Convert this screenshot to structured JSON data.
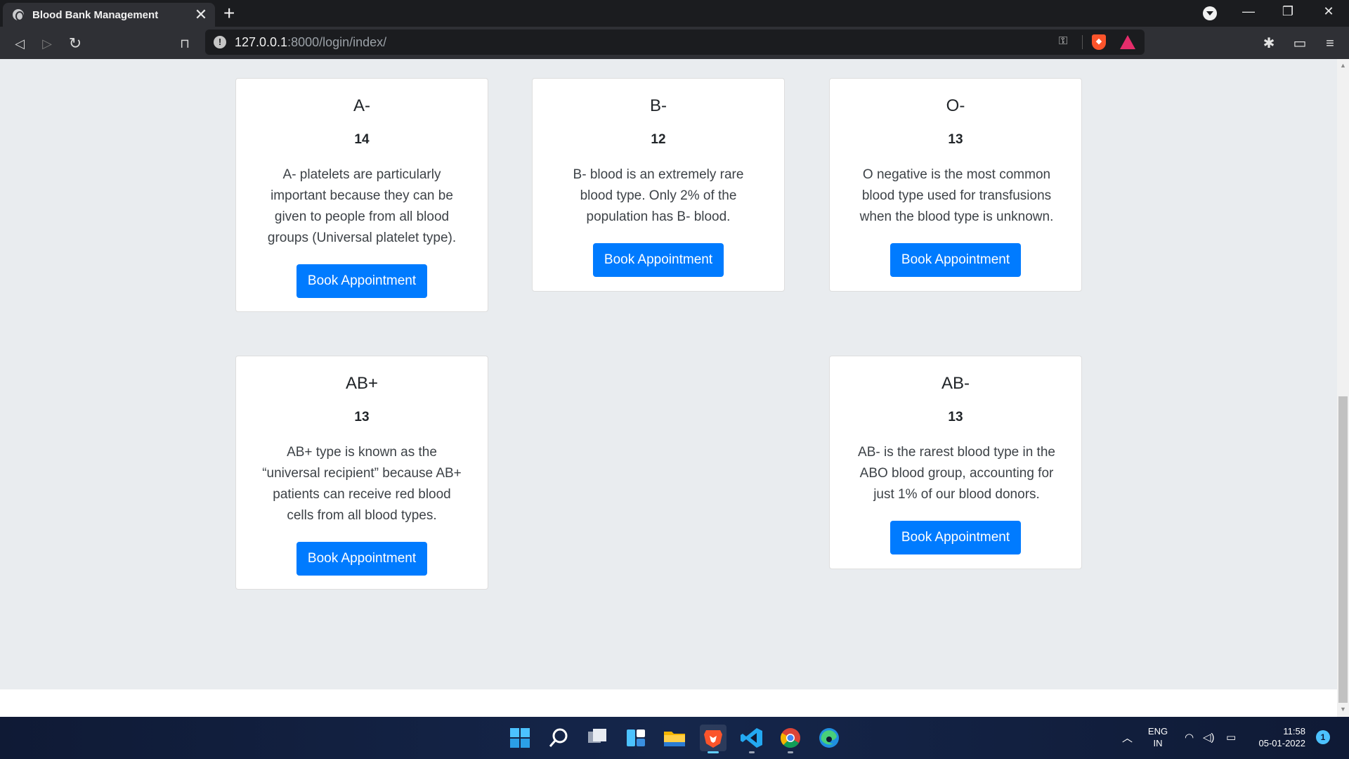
{
  "browser": {
    "tab_title": "Blood Bank Management",
    "tab_close": "✕",
    "new_tab": "+",
    "url_host": "127.0.0.1",
    "url_path": ":8000/login/index/",
    "window_controls": {
      "minimize": "—",
      "restore": "❐",
      "close": "✕"
    }
  },
  "cards": [
    {
      "group": "A-",
      "count": "14",
      "description": "A- platelets are particularly important because they can be given to people from all blood groups (Universal platelet type).",
      "button": "Book Appointment"
    },
    {
      "group": "B-",
      "count": "12",
      "description": "B- blood is an extremely rare blood type. Only 2% of the population has B- blood.",
      "button": "Book Appointment"
    },
    {
      "group": "O-",
      "count": "13",
      "description": "O negative is the most common blood type used for transfusions when the blood type is unknown.",
      "button": "Book Appointment"
    },
    {
      "group": "AB+",
      "count": "13",
      "description": "AB+ type is known as the “universal recipient” because AB+ patients can receive red blood cells from all blood types.",
      "button": "Book Appointment"
    },
    {
      "group": "AB-",
      "count": "13",
      "description": "AB- is the rarest blood type in the ABO blood group, accounting for just 1% of our blood donors.",
      "button": "Book Appointment"
    }
  ],
  "taskbar": {
    "apps": [
      "start-icon",
      "search-icon",
      "task-view-icon",
      "widgets-icon",
      "file-explorer-icon",
      "brave-browser-icon",
      "vscode-icon",
      "chrome-icon",
      "edge-icon"
    ],
    "language": "ENG",
    "region": "IN",
    "time": "11:58",
    "date": "05-01-2022",
    "notification_count": "1"
  },
  "colors": {
    "primary_button": "#007bff",
    "page_background": "#e9ecef",
    "card_background": "#ffffff",
    "chrome_dark": "#1b1c1f",
    "chrome_toolbar": "#2f3035"
  }
}
